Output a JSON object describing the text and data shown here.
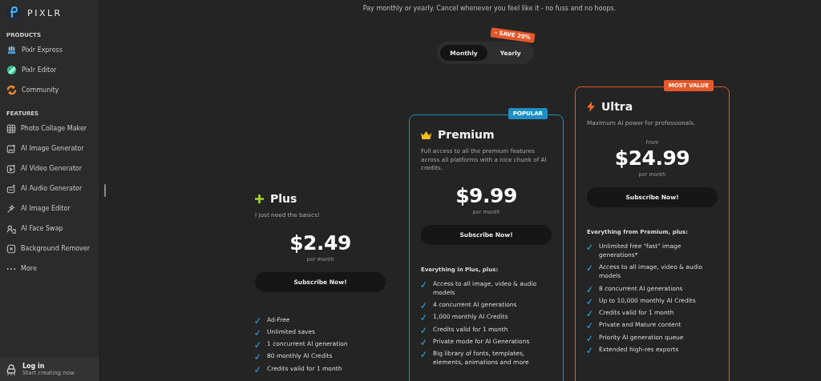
{
  "sidebar": {
    "logo": "PIXLR",
    "sections": [
      {
        "heading": "PRODUCTS",
        "items": [
          {
            "label": "Pixlr Express"
          },
          {
            "label": "Pixlr Editor"
          },
          {
            "label": "Community"
          }
        ]
      },
      {
        "heading": "FEATURES",
        "items": [
          {
            "label": "Photo Collage Maker"
          },
          {
            "label": "AI Image Generator"
          },
          {
            "label": "AI Video Generator"
          },
          {
            "label": "AI Audio Generator"
          },
          {
            "label": "AI Image Editor"
          },
          {
            "label": "AI Face Swap"
          },
          {
            "label": "Background Remover"
          },
          {
            "label": "More"
          }
        ]
      }
    ],
    "login": {
      "title": "Log in",
      "subtitle": "Start creating now"
    }
  },
  "subtitle": "Pay monthly or yearly. Cancel whenever you feel like it - no fuss and no hoops.",
  "billing_tabs": [
    {
      "label": "Monthly",
      "selected": true
    },
    {
      "label": "Yearly",
      "selected": false,
      "badge": "- SAVE 20%"
    }
  ],
  "plans": [
    {
      "name": "Plus",
      "description": "I just need the basics!",
      "price": "$2.49",
      "period": "per month",
      "button": "Subscribe Now!",
      "features": [
        "Ad-Free",
        "Unlimited saves",
        "1 concurrent AI generation",
        "80 monthly AI Credits",
        "Credits valid for 1 month"
      ]
    },
    {
      "name": "Premium",
      "badge": "POPULAR",
      "color": "#1e8fc4",
      "description": "Full access to all the premium features across all platforms with a nice chunk of AI credits.",
      "price": "$9.99",
      "period": "per month",
      "button": "Subscribe Now!",
      "features_heading": "Everything in Plus, plus:",
      "features": [
        "Access to all image, video & audio models",
        "4 concurrent AI generations",
        "1,000 monthly AI Credits",
        "Credits valid for 1 month",
        "Private mode for AI Generations",
        "Big library of fonts, templates, elements, animations and more"
      ]
    },
    {
      "name": "Ultra",
      "badge": "MOST VALUE",
      "color": "#e5582a",
      "description": "Maximum AI power for professionals.",
      "price_prefix": "From",
      "price": "$24.99",
      "period": "per month",
      "button": "Subscribe Now!",
      "features_heading": "Everything from Premium, plus:",
      "features": [
        "Unlimited free \"fast\" image generations*",
        "Access to all image, video & audio models",
        "8 concurrent AI generations",
        "Up to 10,000 monthly AI Credits",
        "Credits valid for 1 month",
        "Private and Mature content",
        "Priority AI generation queue",
        "Extended high-res exports"
      ]
    }
  ]
}
